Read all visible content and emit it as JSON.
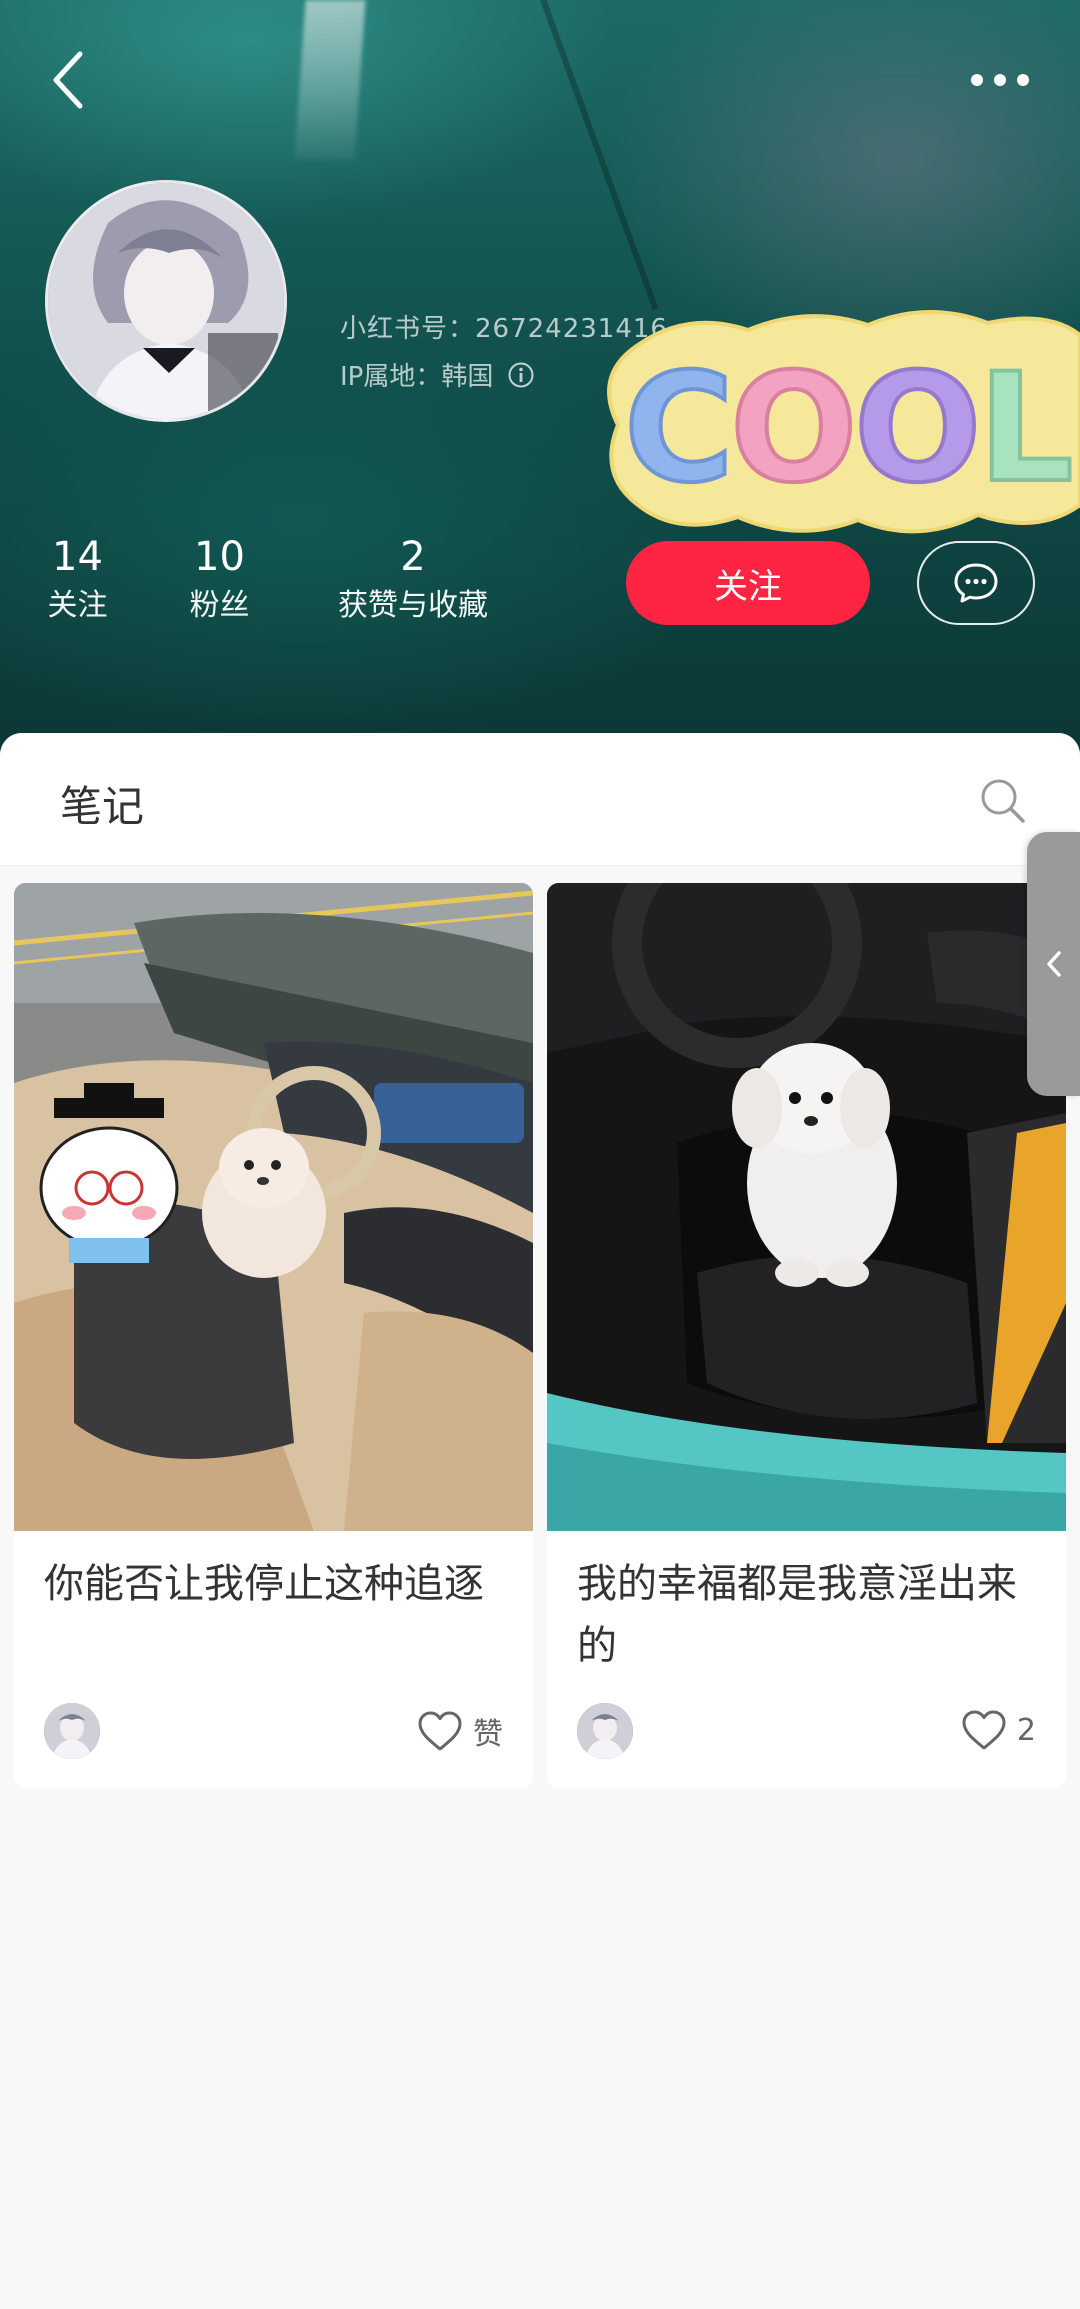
{
  "header": {
    "back_icon": "chevron-left-icon",
    "more_icon": "more-dots-icon"
  },
  "profile": {
    "id_label": "小红书号：26724231416",
    "ip_label": "IP属地：韩国",
    "sticker_text": "COOL"
  },
  "stats": [
    {
      "value": "14",
      "label": "关注"
    },
    {
      "value": "10",
      "label": "粉丝"
    },
    {
      "value": "2",
      "label": "获赞与收藏"
    }
  ],
  "actions": {
    "follow_label": "关注",
    "message_icon": "chat-bubble-icon"
  },
  "content": {
    "tab_label": "笔记",
    "search_icon": "search-icon"
  },
  "notes": [
    {
      "title": "你能否让我停止这种追逐",
      "likes": "赞"
    },
    {
      "title": "我的幸福都是我意淫出来的",
      "likes": "2"
    }
  ],
  "colors": {
    "accent": "#ff2442",
    "banner": "#145753",
    "text": "#333333"
  }
}
